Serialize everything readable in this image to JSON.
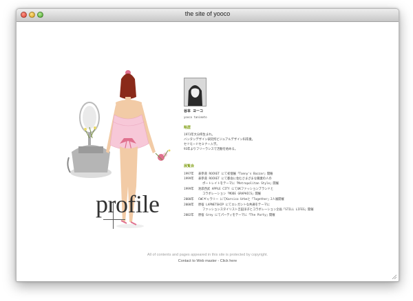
{
  "window": {
    "title": "the site of yooco"
  },
  "profile_word": "profile",
  "person": {
    "name": "谷本 ヨーコ",
    "romaji": "yooco tanimoto"
  },
  "sections": {
    "history_heading": "略歴",
    "exhibitions_heading": "展覧会"
  },
  "history": [
    "1973年大分県生まれ。",
    "バンタンデザイン研究所ビジュアルデザイン科卒業。",
    "セツモードセミナー入学。",
    "93年よりフリーランスで活動を始める。"
  ],
  "exhibitions": [
    {
      "year": "1997年",
      "text": "表参道 ROCKET にて初個展「Tanny's Bazzar」開催"
    },
    {
      "year": "1999年",
      "text": "表参道 ROCKET にて都会に住むさまざまな職業の人の"
    },
    {
      "year": "",
      "text": "ポートレイトをテーマに「Metropolitan Style」開催"
    },
    {
      "year": "1999年",
      "text": "池袋西武 APPLE CITY にてUKファッションブランドと"
    },
    {
      "year": "",
      "text": "コラボレーション「MODE GRAPHICS」開催"
    },
    {
      "year": "2000年",
      "text": "CWCギャラリー にてKarsico Urbeと「Together」2人展開催"
    },
    {
      "year": "2000年",
      "text": "原宿 LAPNETSHIP にてエレガントな共通をテーマに"
    },
    {
      "year": "",
      "text": "ファッションスタイリスト吉田洋子とコラボレーション企画「STILL LIFES」開催"
    },
    {
      "year": "2002年",
      "text": "原宿 Grey にてパーティをテーマに「The Party」開催"
    }
  ],
  "footer": {
    "copyright": "All of contents and pages  appeared in this site is protected by copyright.",
    "contact": "Contact to Web master - Click here"
  },
  "colors": {
    "accent": "#8aa626",
    "dress": "#f7c8d8",
    "ribbon": "#e0708e",
    "hair": "#8a2a1a"
  }
}
